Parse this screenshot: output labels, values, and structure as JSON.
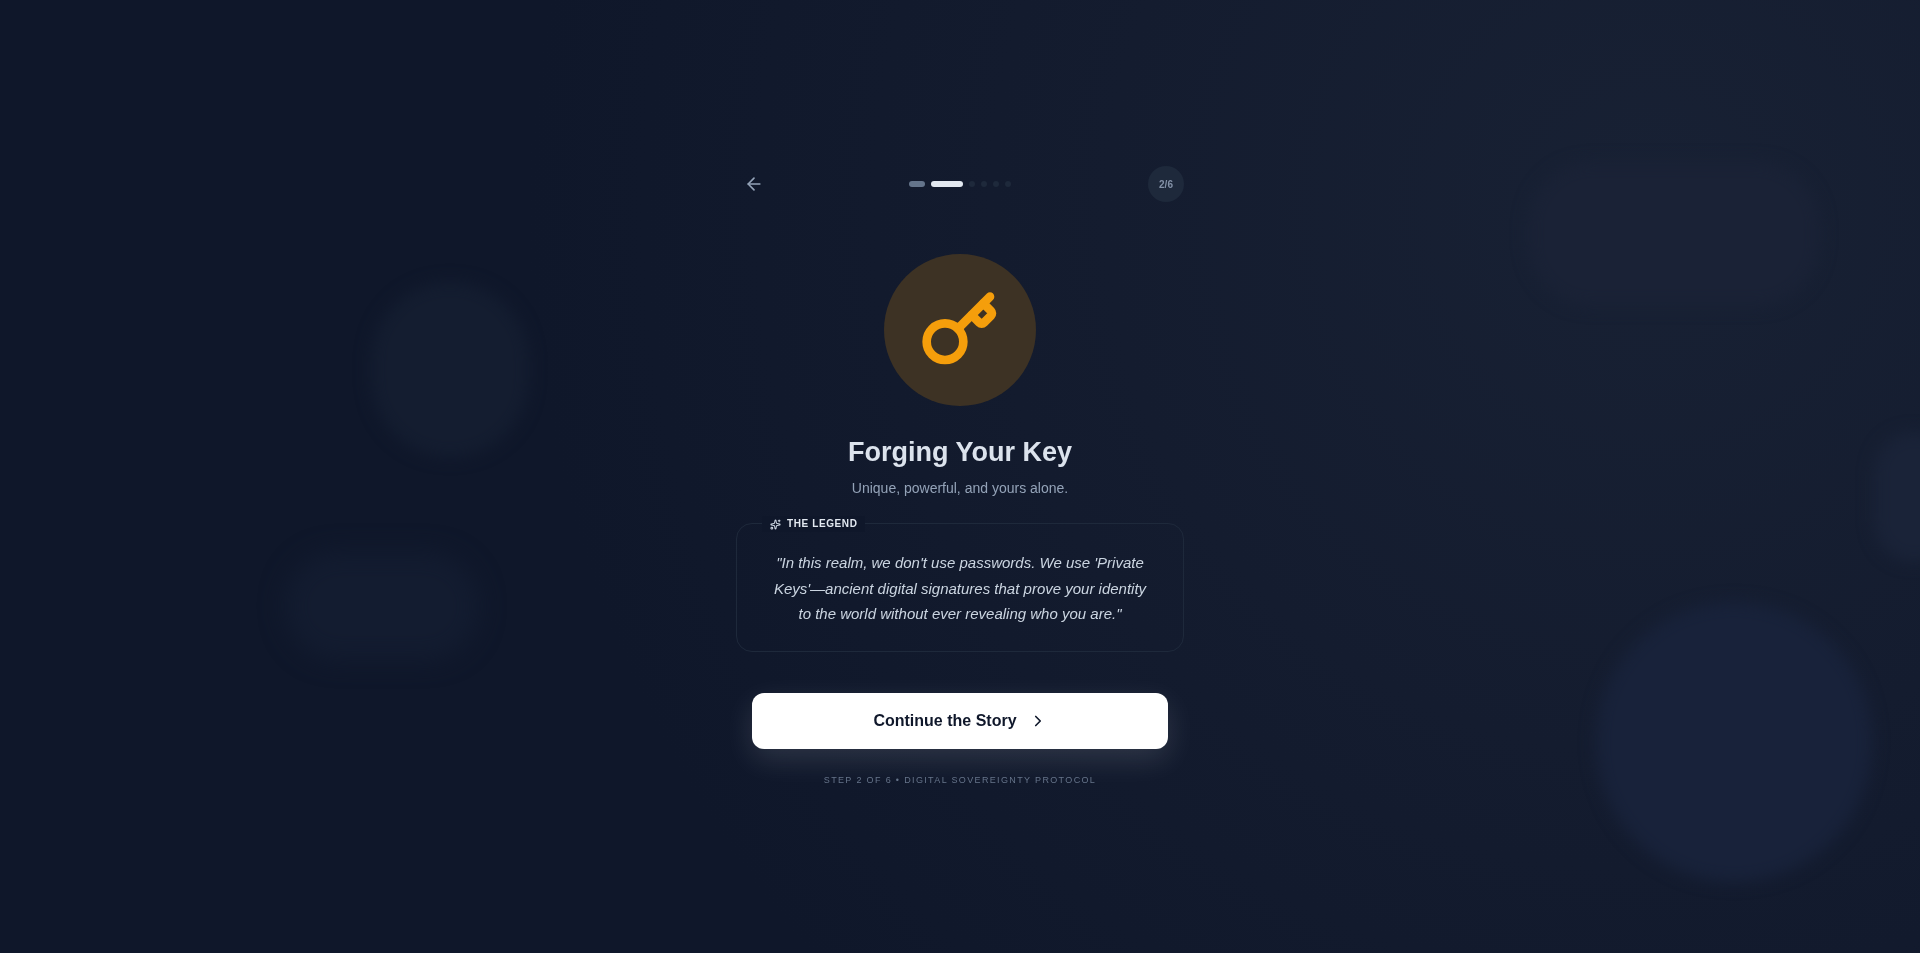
{
  "nav": {
    "steps": [
      {
        "completed": true,
        "selected": false
      },
      {
        "completed": false,
        "selected": true
      },
      {
        "completed": false,
        "selected": false
      },
      {
        "completed": false,
        "selected": false
      },
      {
        "completed": false,
        "selected": false
      },
      {
        "completed": false,
        "selected": false
      }
    ],
    "step_badge": "2/6"
  },
  "hero": {
    "title": "Forging Your Key",
    "subtitle": "Unique, powerful, and yours alone."
  },
  "legend": {
    "label": "THE LEGEND",
    "quote": "\"In this realm, we don't use passwords. We use 'Private Keys'—ancient digital signatures that prove your identity to the world without ever revealing who you are.\""
  },
  "continue_button": {
    "label": "Continue the Story"
  },
  "footer": "STEP 2 OF 6 • DIGITAL SOVEREIGNTY PROTOCOL"
}
